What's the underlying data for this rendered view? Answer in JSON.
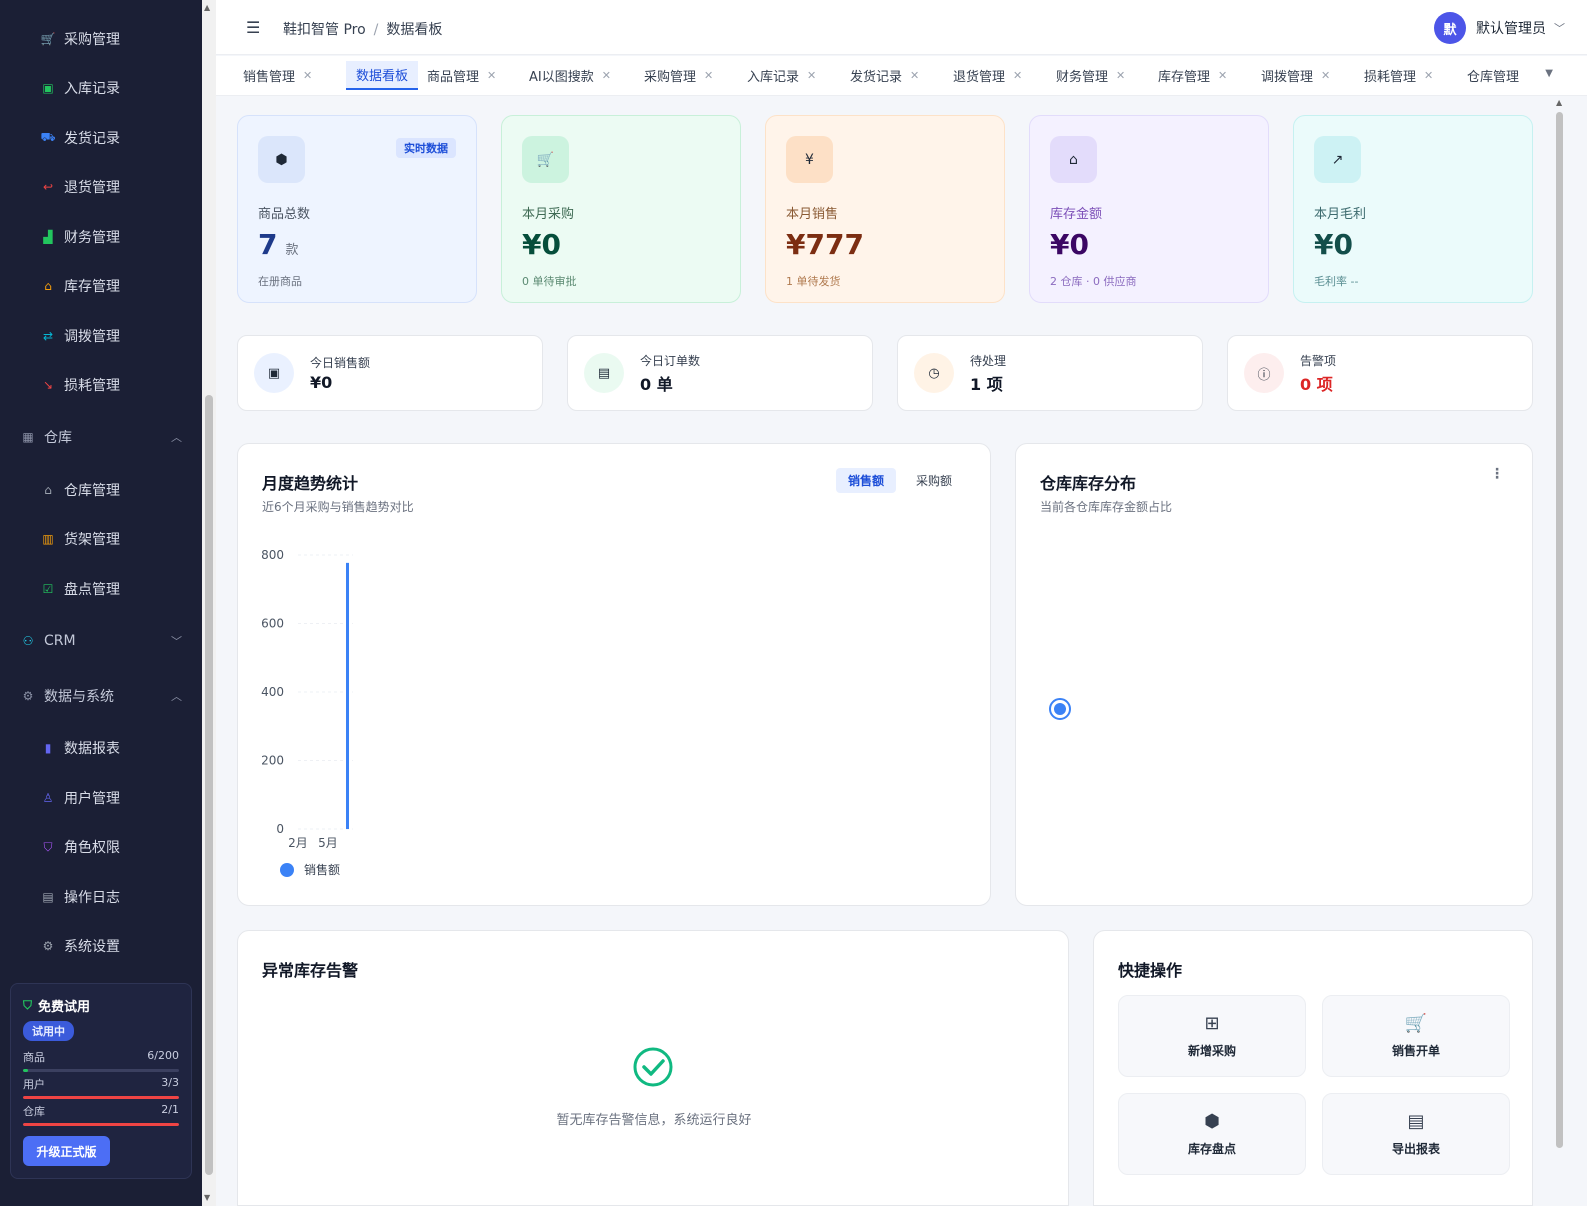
{
  "sidebar": {
    "items": [
      {
        "label": "采购管理",
        "icon": "cart-icon",
        "color": "#f59e0b"
      },
      {
        "label": "入库记录",
        "icon": "inbox-icon",
        "color": "#22c55e"
      },
      {
        "label": "发货记录",
        "icon": "truck-icon",
        "color": "#3b82f6"
      },
      {
        "label": "退货管理",
        "icon": "return-icon",
        "color": "#ef4444"
      },
      {
        "label": "财务管理",
        "icon": "finance-icon",
        "color": "#22c55e"
      },
      {
        "label": "库存管理",
        "icon": "warehouse-icon",
        "color": "#f59e0b"
      },
      {
        "label": "调拨管理",
        "icon": "transfer-icon",
        "color": "#06b6d4"
      },
      {
        "label": "损耗管理",
        "icon": "trend-down-icon",
        "color": "#ef4444"
      }
    ],
    "group_warehouse": "仓库",
    "warehouse_items": [
      {
        "label": "仓库管理",
        "icon": "warehouse-icon",
        "color": "#9ca3af"
      },
      {
        "label": "货架管理",
        "icon": "shelf-icon",
        "color": "#f59e0b"
      },
      {
        "label": "盘点管理",
        "icon": "clipboard-check-icon",
        "color": "#22c55e"
      }
    ],
    "group_crm": "CRM",
    "group_data": "数据与系统",
    "data_items": [
      {
        "label": "数据报表",
        "icon": "bar-chart-icon",
        "color": "#6366f1"
      },
      {
        "label": "用户管理",
        "icon": "user-icon",
        "color": "#6366f1"
      },
      {
        "label": "角色权限",
        "icon": "shield-user-icon",
        "color": "#a855f7"
      },
      {
        "label": "操作日志",
        "icon": "log-icon",
        "color": "#9ca3af"
      },
      {
        "label": "系统设置",
        "icon": "gear-icon",
        "color": "#9ca3af"
      }
    ],
    "trial": {
      "title": "免费试用",
      "badge": "试用中",
      "quotas": [
        {
          "label": "商品",
          "value": "6/200",
          "ratio": 0.03,
          "color": "#22c55e"
        },
        {
          "label": "用户",
          "value": "3/3",
          "ratio": 1.0,
          "color": "#ef4444"
        },
        {
          "label": "仓库",
          "value": "2/1",
          "ratio": 1.0,
          "color": "#ef4444"
        }
      ],
      "upgrade": "升级正式版"
    }
  },
  "header": {
    "app": "鞋扣智管 Pro",
    "sep": "/",
    "page": "数据看板",
    "avatar": "默",
    "user": "默认管理员"
  },
  "tabs": [
    {
      "label": "销售管理",
      "closable": true
    },
    {
      "label": "数据看板",
      "closable": false,
      "active": true
    },
    {
      "label": "商品管理",
      "closable": true
    },
    {
      "label": "AI以图搜款",
      "closable": true
    },
    {
      "label": "采购管理",
      "closable": true
    },
    {
      "label": "入库记录",
      "closable": true
    },
    {
      "label": "发货记录",
      "closable": true
    },
    {
      "label": "退货管理",
      "closable": true
    },
    {
      "label": "财务管理",
      "closable": true
    },
    {
      "label": "库存管理",
      "closable": true
    },
    {
      "label": "调拨管理",
      "closable": true
    },
    {
      "label": "损耗管理",
      "closable": true
    },
    {
      "label": "仓库管理",
      "closable": false
    }
  ],
  "stats": [
    {
      "label": "商品总数",
      "value": "7",
      "unit": "款",
      "sub": "在册商品",
      "tag": "实时数据",
      "icon": "cube-icon",
      "glyph": "⬢",
      "bg": "#eef4ff",
      "border": "#d6e2fb",
      "iconbg": "#dbe6fb",
      "labelColor": "#4b5563",
      "valColor": "#1e3a8a",
      "subColor": "#6b7280"
    },
    {
      "label": "本月采购",
      "value": "¥0",
      "unit": "",
      "sub": "0 单待审批",
      "tag": "",
      "icon": "cart-icon",
      "glyph": "🛒",
      "bg": "#ecfbf3",
      "border": "#c8f0d9",
      "iconbg": "#ccf3df",
      "labelColor": "#3f6b54",
      "valColor": "#064e3b",
      "subColor": "#5b8a72"
    },
    {
      "label": "本月销售",
      "value": "¥777",
      "unit": "",
      "sub": "1 单待发货",
      "tag": "",
      "icon": "yen-icon",
      "glyph": "¥",
      "bg": "#fff4ea",
      "border": "#fde2c8",
      "iconbg": "#fde0c6",
      "labelColor": "#8a5a34",
      "valColor": "#7c2d12",
      "subColor": "#b07a4f"
    },
    {
      "label": "库存金额",
      "value": "¥0",
      "unit": "",
      "sub": "2 仓库 · 0 供应商",
      "tag": "",
      "icon": "warehouse-icon",
      "glyph": "⌂",
      "bg": "#f4f1ff",
      "border": "#e2dcfb",
      "iconbg": "#e3dcfb",
      "labelColor": "#7c4fb8",
      "valColor": "#3b0764",
      "subColor": "#8b6bbf"
    },
    {
      "label": "本月毛利",
      "value": "¥0",
      "unit": "",
      "sub": "毛利率 --",
      "tag": "",
      "icon": "trend-up-icon",
      "glyph": "↗",
      "bg": "#ebfbfb",
      "border": "#c6f1f1",
      "iconbg": "#cdf2f4",
      "labelColor": "#3d6b6f",
      "valColor": "#134e4a",
      "subColor": "#5a8e92"
    }
  ],
  "minis": [
    {
      "label": "今日销售额",
      "value": "¥0",
      "icon": "cash-icon",
      "glyph": "▣",
      "iconbg": "#eaf1ff",
      "valColor": "#111827"
    },
    {
      "label": "今日订单数",
      "value": "0 单",
      "icon": "document-icon",
      "glyph": "▤",
      "iconbg": "#eafaf1",
      "valColor": "#111827"
    },
    {
      "label": "待处理",
      "value": "1 项",
      "icon": "clock-icon",
      "glyph": "◷",
      "iconbg": "#fff3e6",
      "valColor": "#111827"
    },
    {
      "label": "告警项",
      "value": "0 项",
      "icon": "alert-icon",
      "glyph": "ⓘ",
      "iconbg": "#fdeeee",
      "valColor": "#dc2626"
    }
  ],
  "trend": {
    "title": "月度趋势统计",
    "subtitle": "近6个月采购与销售趋势对比",
    "toggle": [
      "销售额",
      "采购额"
    ],
    "active_toggle": 0,
    "legend": "销售额"
  },
  "chart_data": {
    "type": "bar",
    "categories": [
      "2月",
      "5月"
    ],
    "series": [
      {
        "name": "销售额",
        "values": [
          0,
          777
        ]
      }
    ],
    "ylim": [
      0,
      800
    ],
    "yticks": [
      0,
      200,
      400,
      600,
      800
    ],
    "grid": true,
    "legend": "bottom-left",
    "color": "#3b82f6"
  },
  "distribution": {
    "title": "仓库库存分布",
    "subtitle": "当前各仓库库存金额占比"
  },
  "alerts": {
    "title": "异常库存告警",
    "empty": "暂无库存告警信息，系统运行良好"
  },
  "quick": {
    "title": "快捷操作",
    "items": [
      {
        "label": "新增采购",
        "icon": "plus-square-icon",
        "glyph": "⊞"
      },
      {
        "label": "销售开单",
        "icon": "cart-plus-icon",
        "glyph": "🛒"
      },
      {
        "label": "库存盘点",
        "icon": "box-icon",
        "glyph": "⬢"
      },
      {
        "label": "导出报表",
        "icon": "file-chart-icon",
        "glyph": "▤"
      }
    ]
  }
}
